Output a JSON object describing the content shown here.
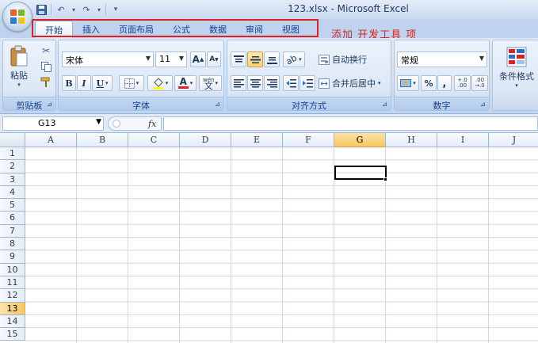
{
  "window": {
    "title": "123.xlsx - Microsoft Excel"
  },
  "qat": {
    "undo_icon": "↶",
    "redo_icon": "↷",
    "customize_icon": "▾"
  },
  "tabs": [
    {
      "label": "开始",
      "active": true
    },
    {
      "label": "插入",
      "active": false
    },
    {
      "label": "页面布局",
      "active": false
    },
    {
      "label": "公式",
      "active": false
    },
    {
      "label": "数据",
      "active": false
    },
    {
      "label": "审阅",
      "active": false
    },
    {
      "label": "视图",
      "active": false
    }
  ],
  "annotation": {
    "text": "添加 开发工具 项",
    "color": "#e02020"
  },
  "clipboard": {
    "paste_label": "粘贴",
    "group_label": "剪贴板"
  },
  "font": {
    "font_name": "宋体",
    "font_size": "11",
    "bold": "B",
    "italic": "I",
    "underline": "U",
    "grow": "A",
    "shrink": "A",
    "font_color_letter": "A",
    "phonetic": "wén",
    "group_label": "字体"
  },
  "alignment": {
    "wrap_text": "自动换行",
    "merge_center": "合并后居中",
    "group_label": "对齐方式"
  },
  "number": {
    "format": "常规",
    "percent": "%",
    "comma": ",",
    "inc_decimal": "+.0\n.00",
    "dec_decimal": ".00\n→.0",
    "group_label": "数字"
  },
  "styles": {
    "conditional_format": "条件格式"
  },
  "formula_bar": {
    "name_box": "G13",
    "fx_label": "fx",
    "content": ""
  },
  "sheet": {
    "columns": [
      "A",
      "B",
      "C",
      "D",
      "E",
      "F",
      "G",
      "H",
      "I",
      "J"
    ],
    "rows": [
      "1",
      "2",
      "3",
      "4",
      "5",
      "6",
      "7",
      "8",
      "9",
      "10",
      "11",
      "12",
      "13",
      "14",
      "15"
    ],
    "selected_column": "G",
    "selected_row": "13"
  },
  "colors": {
    "ribbon_bg": "#d1e0f2",
    "tab_text": "#15428b",
    "selection_header": "#f8c764",
    "highlight_box": "#e02020"
  }
}
